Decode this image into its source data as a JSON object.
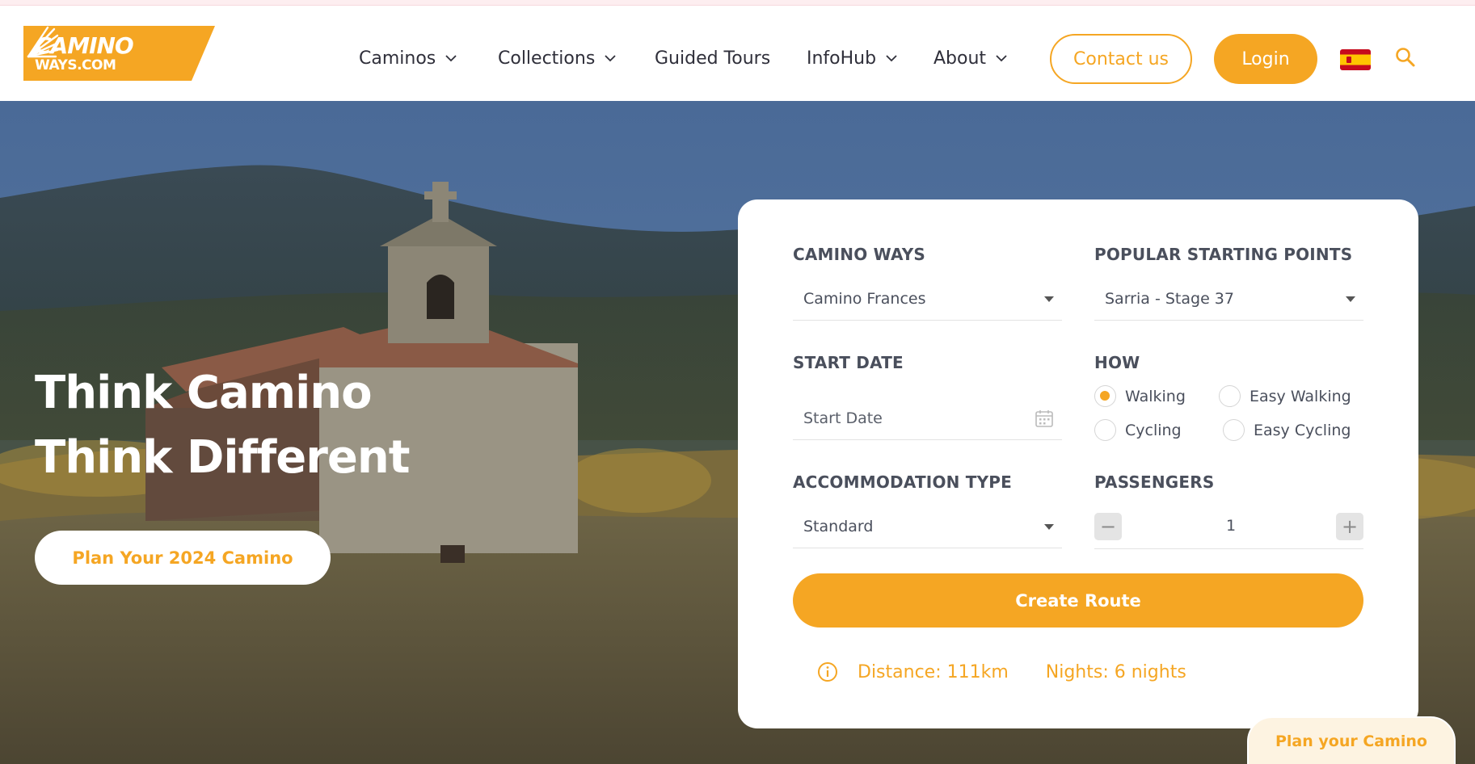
{
  "brand": {
    "line1": "CAMINO",
    "line2": "WAYS.COM"
  },
  "nav": {
    "caminos": "Caminos",
    "collections": "Collections",
    "guided_tours": "Guided Tours",
    "infohub": "InfoHub",
    "about": "About"
  },
  "header": {
    "contact_label": "Contact us",
    "login_label": "Login",
    "language_flag": "spain-flag-icon"
  },
  "hero": {
    "title_line1": "Think Camino",
    "title_line2": "Think Different",
    "cta_label": "Plan Your 2024 Camino"
  },
  "booking": {
    "camino_ways_label": "CAMINO WAYS",
    "camino_ways_value": "Camino Frances",
    "starting_points_label": "POPULAR STARTING POINTS",
    "starting_points_value": "Sarria - Stage 37",
    "start_date_label": "START DATE",
    "start_date_placeholder": "Start Date",
    "how_label": "HOW",
    "how_options": [
      "Walking",
      "Easy Walking",
      "Cycling",
      "Easy Cycling"
    ],
    "how_selected": "Walking",
    "accommodation_label": "ACCOMMODATION TYPE",
    "accommodation_value": "Standard",
    "passengers_label": "PASSENGERS",
    "passengers_minus": "−",
    "passengers_plus": "+",
    "passengers_value": "1",
    "create_label": "Create Route",
    "distance": "Distance: 111km",
    "nights": "Nights: 6 nights"
  },
  "floating": {
    "plan_label": "Plan your Camino"
  },
  "colors": {
    "accent": "#f5a623",
    "text": "#2f2f3a",
    "muted": "#4a4f5c"
  }
}
